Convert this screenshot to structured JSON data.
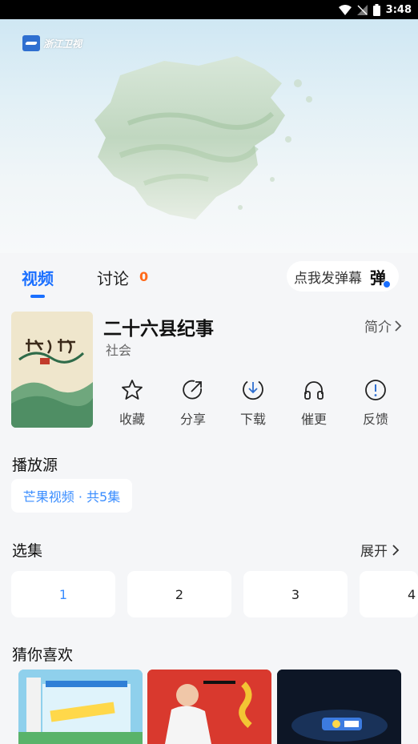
{
  "status_bar": {
    "time": "3:48"
  },
  "player": {
    "channel_logo_text": "浙江卫视"
  },
  "tabs": {
    "video_label": "视频",
    "discuss_label": "讨论",
    "discuss_count": "0",
    "danmu_button_label": "点我发弹幕",
    "danmu_icon_text": "弹"
  },
  "show": {
    "title": "二十六县纪事",
    "genre": "社会",
    "intro_label": "简介"
  },
  "actions": [
    {
      "label": "收藏",
      "icon": "star-icon"
    },
    {
      "label": "分享",
      "icon": "share-icon"
    },
    {
      "label": "下载",
      "icon": "download-icon"
    },
    {
      "label": "催更",
      "icon": "headphones-icon"
    },
    {
      "label": "反馈",
      "icon": "feedback-icon"
    }
  ],
  "source": {
    "section_title": "播放源",
    "chip_label": "芒果视频 · 共5集"
  },
  "episodes": {
    "section_title": "选集",
    "expand_label": "展开",
    "items": [
      "1",
      "2",
      "3",
      "4"
    ],
    "selected": "1"
  },
  "recommend": {
    "section_title": "猜你喜欢"
  },
  "colors": {
    "accent": "#1a6fff",
    "count": "#ff6a1a",
    "chip_text": "#3a8dff",
    "background": "#f5f6f8"
  }
}
